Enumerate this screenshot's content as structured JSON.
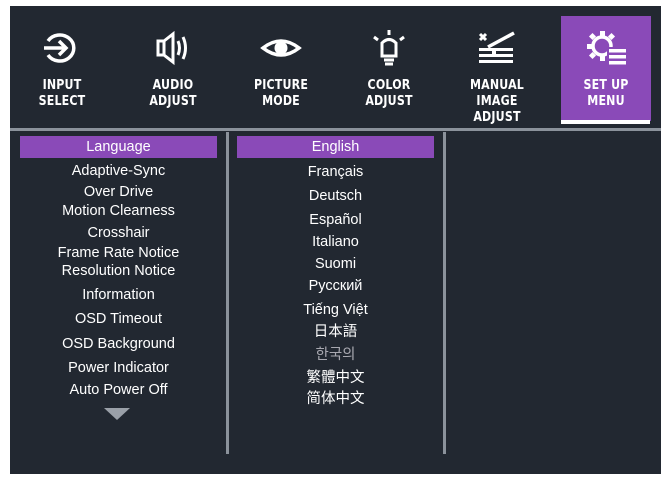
{
  "tabs": [
    {
      "label": "INPUT\nSELECT",
      "icon": "input-select-icon"
    },
    {
      "label": "AUDIO\nADJUST",
      "icon": "speaker-icon"
    },
    {
      "label": "PICTURE\nMODE",
      "icon": "eye-icon"
    },
    {
      "label": "COLOR\nADJUST",
      "icon": "bulb-icon"
    },
    {
      "label": "MANUAL\nIMAGE ADJUST",
      "icon": "manual-adjust-icon"
    },
    {
      "label": "SET UP\nMENU",
      "icon": "gear-menu-icon",
      "active": true
    }
  ],
  "setup_menu": {
    "items": [
      "Language",
      "Adaptive-Sync",
      "Over Drive",
      "Motion Clearness",
      "Crosshair",
      "Frame Rate Notice",
      "Resolution Notice",
      "Information",
      "OSD Timeout",
      "OSD Background",
      "Power Indicator",
      "Auto Power Off"
    ],
    "selected": "Language",
    "more_indicator": "down-triangle-icon"
  },
  "language_menu": {
    "options": [
      "English",
      "Français",
      "Deutsch",
      "Español",
      "Italiano",
      "Suomi",
      "Русский",
      "Tiếng Việt",
      "日本語",
      "한국의",
      "繁體中文",
      "简体中文"
    ],
    "selected": "English",
    "dimmed": "한국의"
  },
  "colors": {
    "background": "#222831",
    "accent": "#8a4ab8",
    "divider": "#8b929b",
    "text": "#ffffff"
  }
}
